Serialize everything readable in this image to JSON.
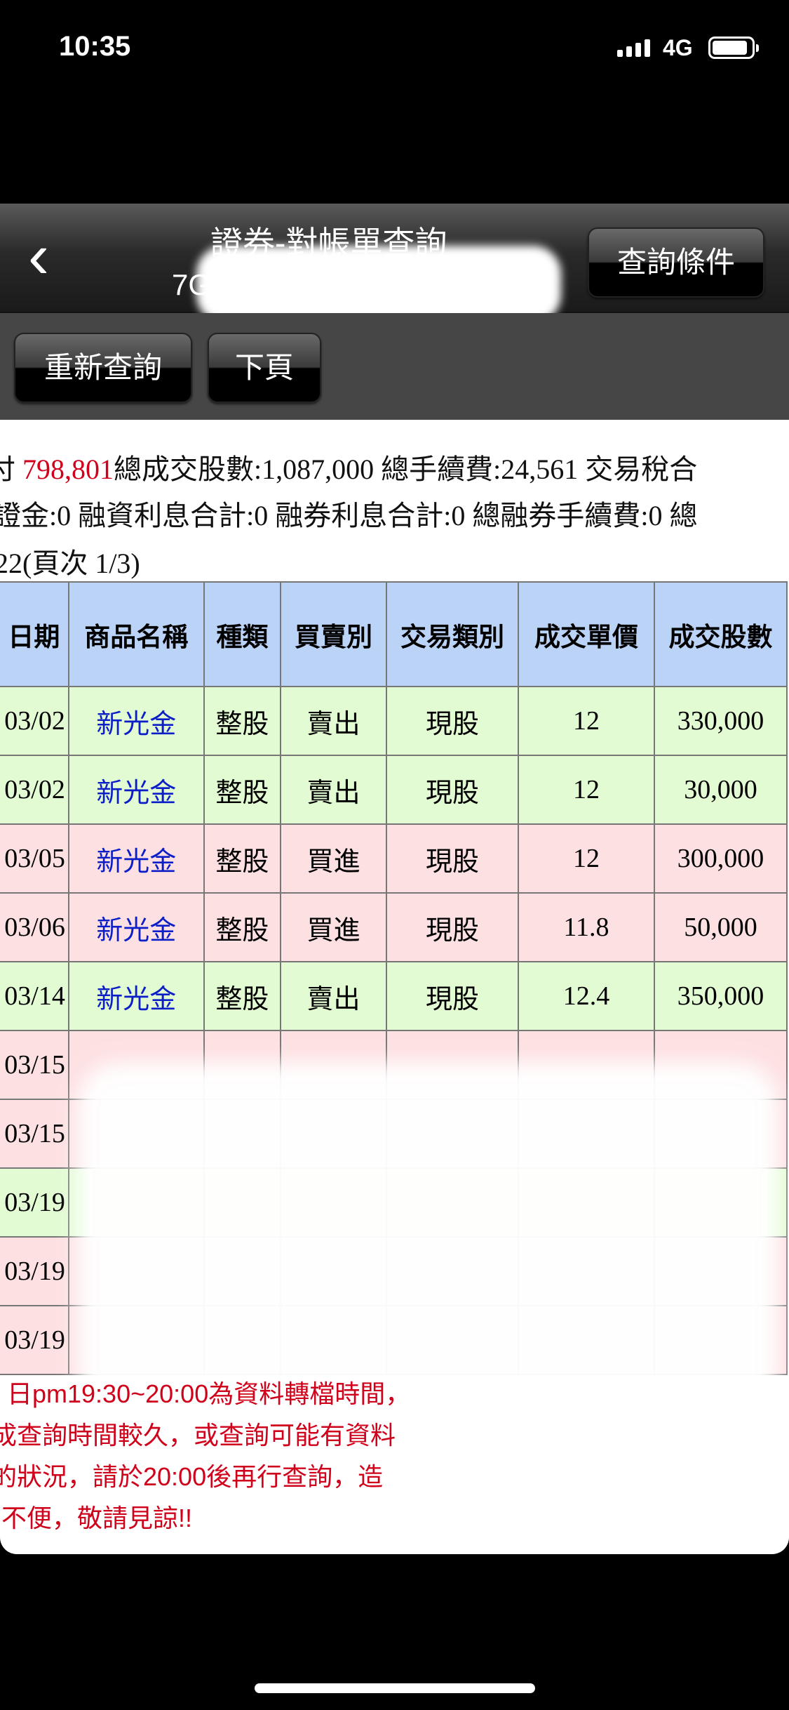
{
  "status": {
    "time": "10:35",
    "network": "4G"
  },
  "nav": {
    "title": "證券-對帳單查詢",
    "account": "7G",
    "query_conditions": "查詢條件"
  },
  "toolbar": {
    "requery": "重新查詢",
    "next_page": "下頁"
  },
  "summary": {
    "line1_prefix": "付",
    "net_amount": "798,801",
    "line1_rest": "總成交股數:1,087,000 總手續費:24,561 交易稅合",
    "line2": "證金:0 融資利息合計:0 融券利息合計:0 總融券手續費:0 總",
    "line3": "22(頁次 1/3)"
  },
  "table": {
    "headers": [
      "日期",
      "商品名稱",
      "種類",
      "買賣別",
      "交易類別",
      "成交單價",
      "成交股數"
    ],
    "rows": [
      {
        "side": "sell",
        "cells": [
          "03/02",
          "新光金",
          "整股",
          "賣出",
          "現股",
          "12",
          "330,000"
        ]
      },
      {
        "side": "sell",
        "cells": [
          "03/02",
          "新光金",
          "整股",
          "賣出",
          "現股",
          "12",
          "30,000"
        ]
      },
      {
        "side": "buy",
        "cells": [
          "03/05",
          "新光金",
          "整股",
          "買進",
          "現股",
          "12",
          "300,000"
        ]
      },
      {
        "side": "buy",
        "cells": [
          "03/06",
          "新光金",
          "整股",
          "買進",
          "現股",
          "11.8",
          "50,000"
        ]
      },
      {
        "side": "sell",
        "cells": [
          "03/14",
          "新光金",
          "整股",
          "賣出",
          "現股",
          "12.4",
          "350,000"
        ]
      },
      {
        "side": "buy",
        "cells": [
          "03/15",
          "",
          "",
          "",
          "",
          "",
          ""
        ]
      },
      {
        "side": "buy",
        "cells": [
          "03/15",
          "",
          "",
          "",
          "",
          "",
          ""
        ]
      },
      {
        "side": "sell",
        "cells": [
          "03/19",
          "",
          "",
          "",
          "",
          "",
          ""
        ]
      },
      {
        "side": "buy",
        "cells": [
          "03/19",
          "",
          "",
          "",
          "",
          "",
          ""
        ]
      },
      {
        "side": "buy",
        "cells": [
          "03/19",
          "",
          "",
          "",
          "",
          "",
          ""
        ]
      }
    ]
  },
  "note": [
    "日pm19:30~20:00為資料轉檔時間，",
    "成查詢時間較久，或查詢可能有資料",
    "的狀況，請於20:00後再行查詢，造",
    "不便，敬請見諒!!"
  ]
}
